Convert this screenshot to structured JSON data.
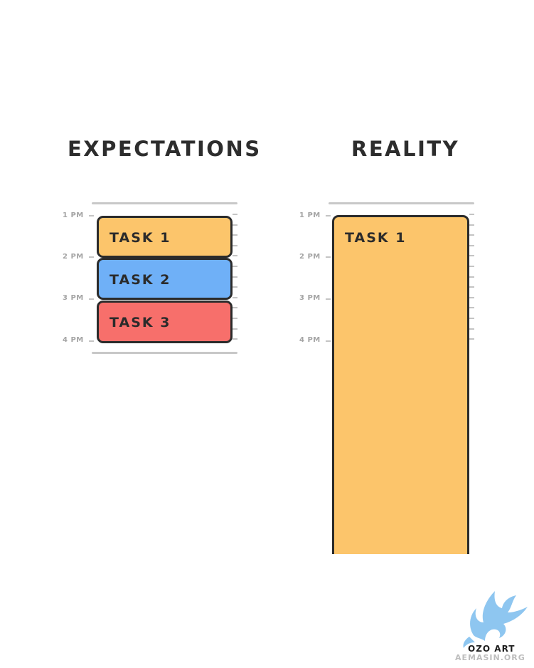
{
  "expectations": {
    "title": "EXPECTATIONS",
    "time_labels": [
      "1 PM",
      "2 PM",
      "3 PM",
      "4 PM"
    ],
    "tasks": [
      {
        "label": "TASK 1",
        "color": "#fcc56b"
      },
      {
        "label": "TASK 2",
        "color": "#6fb0f7"
      },
      {
        "label": "TASK 3",
        "color": "#f76f6b"
      }
    ]
  },
  "reality": {
    "title": "REALITY",
    "time_labels": [
      "1 PM",
      "2 PM",
      "3 PM",
      "4 PM"
    ],
    "tasks": [
      {
        "label": "TASK 1",
        "color": "#fcc56b"
      }
    ]
  },
  "watermark": {
    "brand": "OZO ART",
    "site": "AEMASIN.ORG",
    "color": "#8ec6f0"
  }
}
